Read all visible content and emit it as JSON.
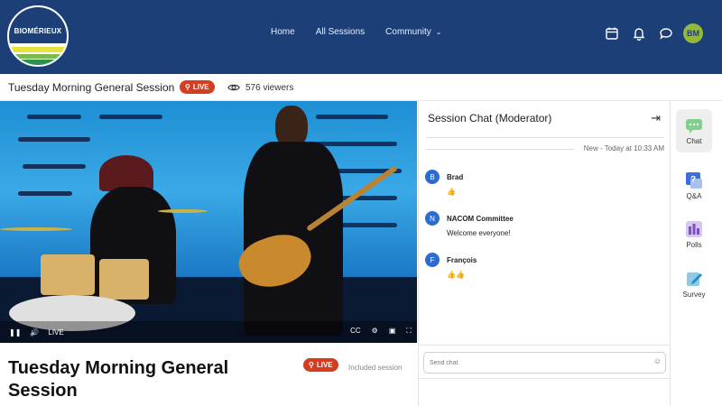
{
  "header": {
    "logo_text": "BIOMÉRIEUX",
    "nav": [
      {
        "label": "Home"
      },
      {
        "label": "All Sessions"
      },
      {
        "label": "Community",
        "has_dropdown": true
      }
    ],
    "icons": [
      "calendar-icon",
      "bell-icon",
      "chat-bubble-icon"
    ],
    "avatar_initials": "BM",
    "colors": {
      "bar": "#1c3f78",
      "avatar": "#93b83d"
    }
  },
  "session": {
    "title": "Tuesday Morning General Session",
    "live_label": "LIVE",
    "viewers": "576 viewers",
    "included": "Included session",
    "live_color": "#d43d20"
  },
  "video": {
    "live_label": "LIVE",
    "controls": [
      "pause-icon",
      "volume-icon",
      "captions-icon",
      "settings-icon",
      "pip-icon",
      "fullscreen-icon"
    ]
  },
  "chat": {
    "title": "Session Chat (Moderator)",
    "separator": "New - Today at 10:33 AM",
    "messages": [
      {
        "initial": "B",
        "name": "Brad",
        "text": "👍"
      },
      {
        "initial": "N",
        "name": "NACOM Committee",
        "text": "Welcome everyone!"
      },
      {
        "initial": "F",
        "name": "François",
        "text": "👍👍"
      }
    ],
    "input_placeholder": "Send chat"
  },
  "rail": [
    {
      "label": "Chat",
      "icon": "chat-icon",
      "active": true
    },
    {
      "label": "Q&A",
      "icon": "question-icon",
      "active": false
    },
    {
      "label": "Polls",
      "icon": "polls-icon",
      "active": false
    },
    {
      "label": "Survey",
      "icon": "survey-icon",
      "active": false
    }
  ]
}
